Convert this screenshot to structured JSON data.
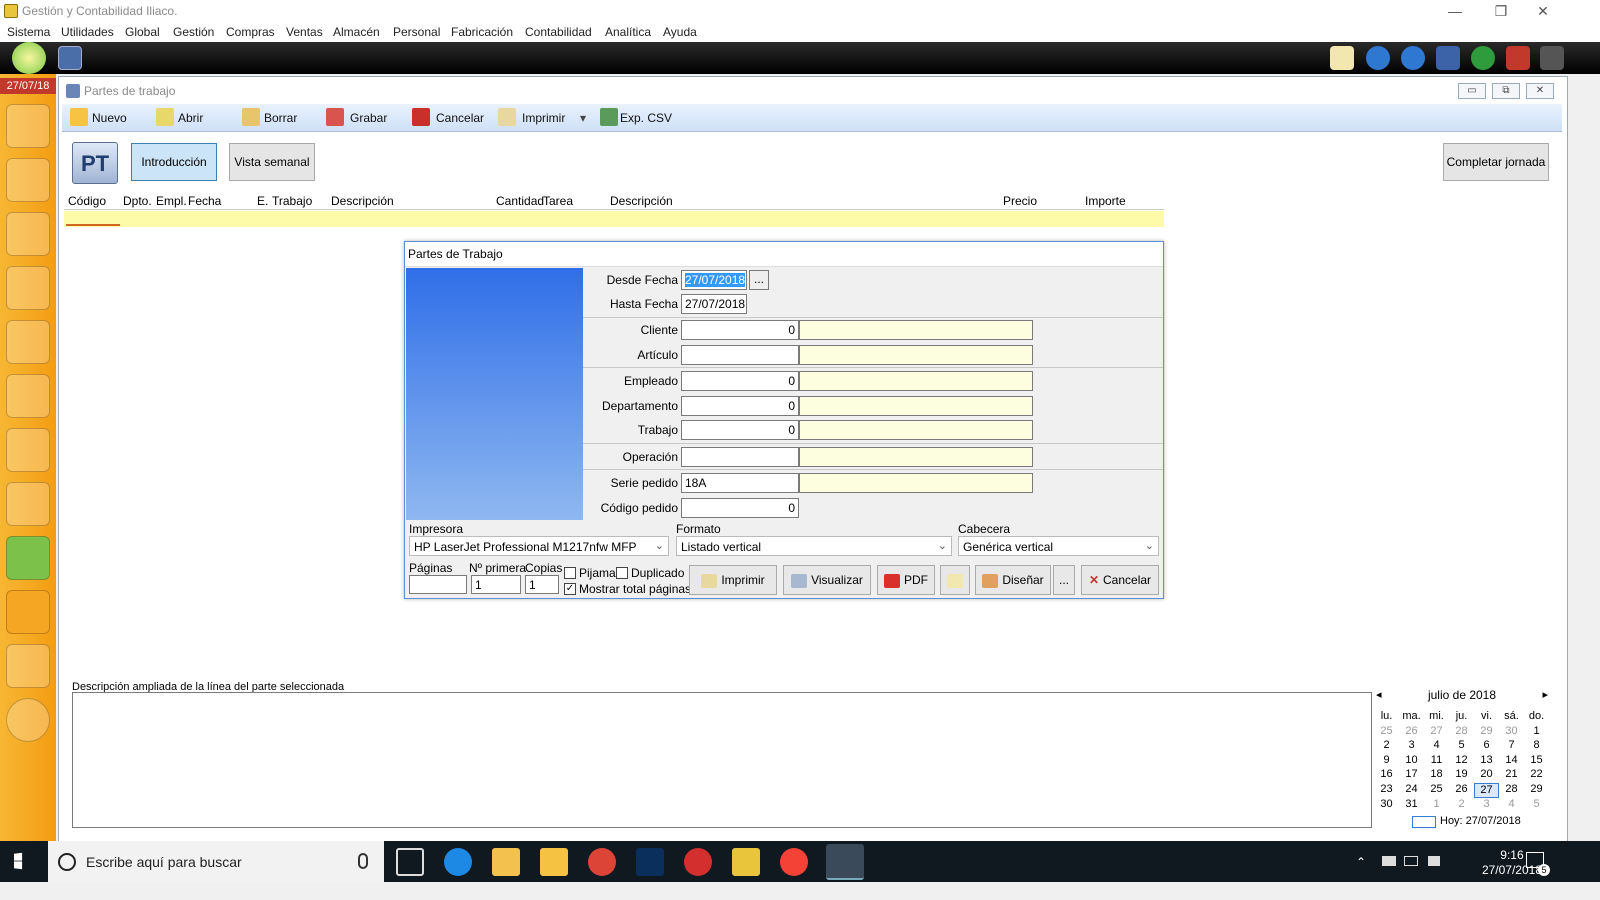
{
  "window": {
    "title": "Gestión y Contabilidad Iliaco.",
    "min": "—",
    "max": "❐",
    "close": "✕"
  },
  "menu": [
    "Sistema",
    "Utilidades",
    "Global",
    "Gestión",
    "Compras",
    "Ventas",
    "Almacén",
    "Personal",
    "Fabricación",
    "Contabilidad",
    "Analítica",
    "Ayuda"
  ],
  "sidebar": {
    "date": "27/07/18",
    "icons": [
      "users-icon",
      "user-icon",
      "user-p-icon",
      "user-a-icon",
      "letter-a-icon",
      "letter-f-icon",
      "letter-f2-icon",
      "fc-icon",
      "bag-green-icon",
      "bag-orange-icon",
      "book-icon",
      "cd-icon"
    ]
  },
  "mdi": {
    "title": "Partes de trabajo",
    "min": "▭",
    "max": "⧉",
    "close": "✕"
  },
  "ribbon": {
    "nuevo": "Nuevo",
    "abrir": "Abrir",
    "borrar": "Borrar",
    "grabar": "Grabar",
    "cancelar": "Cancelar",
    "imprimir": "Imprimir",
    "dropdown": "▾",
    "csv": "Exp. CSV"
  },
  "tabs": {
    "logo": "PT",
    "introduccion": "Introducción",
    "semanal": "Vista semanal",
    "completar": "Completar jornada"
  },
  "grid": {
    "columns": [
      "Código",
      "Dpto.",
      "Empl.",
      "Fecha",
      "E.",
      "Trabajo",
      "Descripción",
      "Cantidad",
      "Tarea",
      "Descripción",
      "Precio",
      "Importe"
    ]
  },
  "dialog": {
    "title": "Partes de Trabajo",
    "desde_fecha_label": "Desde Fecha",
    "desde_fecha": "27/07/2018",
    "ellipsis": "...",
    "hasta_fecha_label": "Hasta Fecha",
    "hasta_fecha": "27/07/2018",
    "cliente_label": "Cliente",
    "cliente": "0",
    "articulo_label": "Artículo",
    "articulo": "",
    "empleado_label": "Empleado",
    "empleado": "0",
    "departamento_label": "Departamento",
    "departamento": "0",
    "trabajo_label": "Trabajo",
    "trabajo": "0",
    "operacion_label": "Operación",
    "operacion": "",
    "serie_label": "Serie pedido",
    "serie": "18A",
    "codigo_label": "Código pedido",
    "codigo": "0",
    "impresora_label": "Impresora",
    "impresora": "HP LaserJet Professional M1217nfw MFP",
    "formato_label": "Formato",
    "formato": "Listado vertical",
    "cabecera_label": "Cabecera",
    "cabecera": "Genérica vertical",
    "paginas_label": "Páginas",
    "primera_label": "Nº primera",
    "primera": "1",
    "copias_label": "Copias",
    "copias": "1",
    "pijama_label": "Pijama",
    "duplicado_label": "Duplicado",
    "mostrar_label": "Mostrar total páginas",
    "imprimir": "Imprimir",
    "visualizar": "Visualizar",
    "pdf": "PDF",
    "disenar": "Diseñar",
    "more": "...",
    "cancelar": "Cancelar"
  },
  "description": {
    "label": "Descripción ampliada de la línea del parte seleccionada"
  },
  "calendar": {
    "month": "julio de 2018",
    "prev": "◂",
    "next": "▸",
    "days": [
      "lu.",
      "ma.",
      "mi.",
      "ju.",
      "vi.",
      "sá.",
      "do."
    ],
    "weeks": [
      [
        "25",
        "26",
        "27",
        "28",
        "29",
        "30",
        "1"
      ],
      [
        "2",
        "3",
        "4",
        "5",
        "6",
        "7",
        "8"
      ],
      [
        "9",
        "10",
        "11",
        "12",
        "13",
        "14",
        "15"
      ],
      [
        "16",
        "17",
        "18",
        "19",
        "20",
        "21",
        "22"
      ],
      [
        "23",
        "24",
        "25",
        "26",
        "27",
        "28",
        "29"
      ],
      [
        "30",
        "31",
        "1",
        "2",
        "3",
        "4",
        "5"
      ]
    ],
    "today": "Hoy: 27/07/2018"
  },
  "taskbar": {
    "search_placeholder": "Escribe aquí para buscar",
    "time": "9:16",
    "date": "27/07/2018",
    "notif": "5"
  }
}
